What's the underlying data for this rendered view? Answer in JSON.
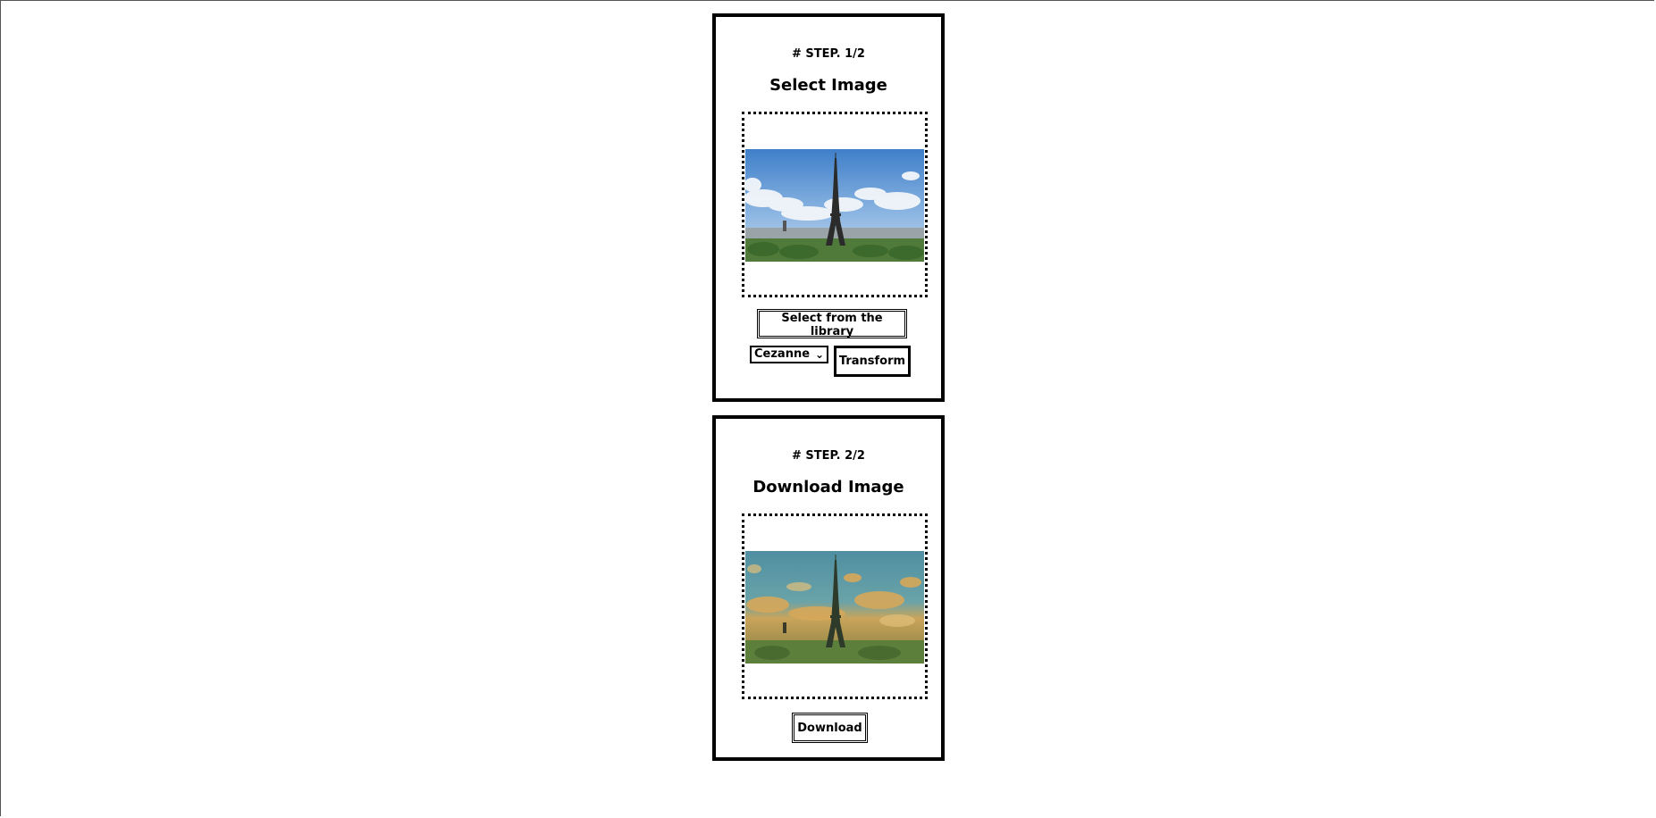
{
  "step1": {
    "step_label": "# STEP. 1/2",
    "title": "Select Image",
    "select_button_label": "Select from the library",
    "style_select_value": "Cezanne",
    "transform_button_label": "Transform"
  },
  "step2": {
    "step_label": "# STEP. 2/2",
    "title": "Download Image",
    "download_button_label": "Download"
  },
  "icons": {
    "select_chevron": "chevron-down-icon"
  }
}
